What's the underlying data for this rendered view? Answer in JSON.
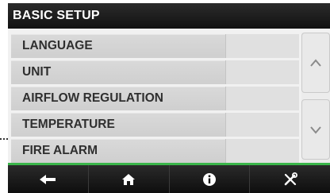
{
  "header": {
    "title": "BASIC SETUP"
  },
  "menu": {
    "items": [
      {
        "label": "LANGUAGE"
      },
      {
        "label": "UNIT"
      },
      {
        "label": "AIRFLOW REGULATION"
      },
      {
        "label": "TEMPERATURE"
      },
      {
        "label": "FIRE ALARM"
      }
    ]
  },
  "scroll": {
    "up_icon": "chevron-up-icon",
    "down_icon": "chevron-down-icon"
  },
  "navbar": {
    "buttons": [
      {
        "icon": "back-arrow-icon"
      },
      {
        "icon": "home-icon"
      },
      {
        "icon": "info-icon"
      },
      {
        "icon": "tools-icon"
      }
    ]
  },
  "colors": {
    "accent": "#3ab54a",
    "bar": "#1a1a1a",
    "row": "#d6d6d6"
  }
}
